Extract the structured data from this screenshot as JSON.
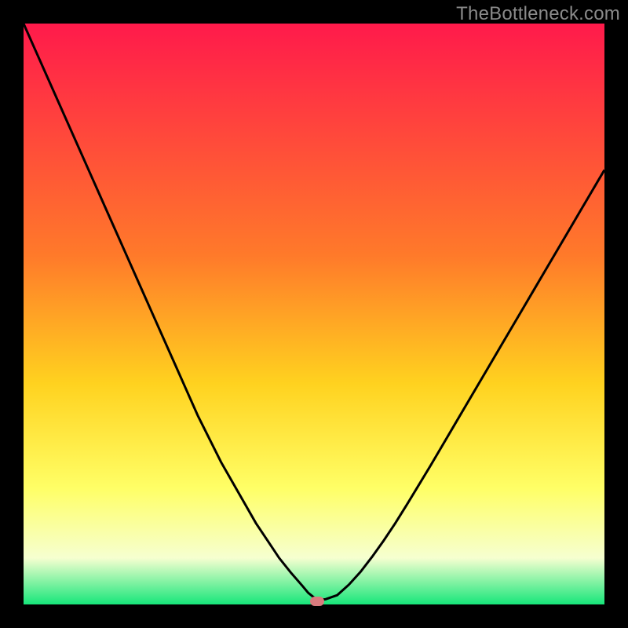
{
  "watermark": {
    "text": "TheBottleneck.com"
  },
  "colors": {
    "gradient_top": "#ff1a4b",
    "gradient_mid1": "#ff7a2a",
    "gradient_mid2": "#ffd21f",
    "gradient_mid3": "#ffff66",
    "gradient_mid4": "#f6ffd0",
    "gradient_bottom": "#17e67a",
    "curve": "#000000",
    "marker": "#d97b7e",
    "frame": "#000000"
  },
  "chart_data": {
    "type": "line",
    "title": "",
    "xlabel": "",
    "ylabel": "",
    "xlim": [
      0,
      100
    ],
    "ylim": [
      0,
      100
    ],
    "x": [
      0,
      2,
      4,
      6,
      8,
      10,
      12,
      14,
      16,
      18,
      20,
      22,
      24,
      26,
      28,
      30,
      32,
      34,
      36,
      38,
      40,
      42,
      44,
      46,
      48,
      49,
      50,
      51,
      52,
      54,
      56,
      58,
      60,
      62,
      64,
      66,
      68,
      70,
      72,
      74,
      76,
      78,
      80,
      82,
      84,
      86,
      88,
      90,
      92,
      94,
      96,
      98,
      100
    ],
    "series": [
      {
        "name": "bottleneck-curve",
        "values": [
          100,
          95.5,
          91,
          86.5,
          82,
          77.5,
          73,
          68.5,
          64,
          59.5,
          55,
          50.5,
          46,
          41.5,
          37,
          32.5,
          28.5,
          24.5,
          21,
          17.5,
          14,
          11,
          8,
          5.5,
          3.2,
          2,
          1.2,
          0.8,
          0.9,
          1.6,
          3.4,
          5.6,
          8.2,
          11,
          14,
          17.2,
          20.5,
          23.8,
          27.2,
          30.6,
          34,
          37.4,
          40.8,
          44.2,
          47.6,
          51,
          54.4,
          57.8,
          61.2,
          64.6,
          68,
          71.4,
          74.8
        ]
      }
    ],
    "marker": {
      "x": 50.5,
      "y": 0.6
    },
    "gradient_stops": [
      {
        "pos": 0.0,
        "color_key": "gradient_top"
      },
      {
        "pos": 0.4,
        "color_key": "gradient_mid1"
      },
      {
        "pos": 0.62,
        "color_key": "gradient_mid2"
      },
      {
        "pos": 0.8,
        "color_key": "gradient_mid3"
      },
      {
        "pos": 0.92,
        "color_key": "gradient_mid4"
      },
      {
        "pos": 1.0,
        "color_key": "gradient_bottom"
      }
    ]
  }
}
